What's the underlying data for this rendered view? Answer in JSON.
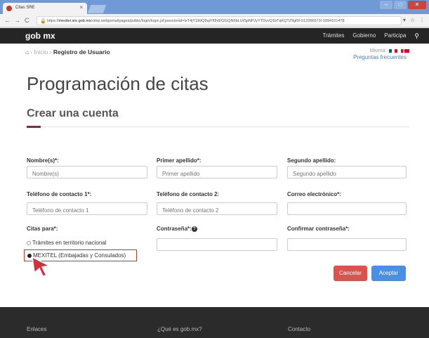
{
  "browser": {
    "tab_title": "Citas SRE",
    "tab_close": "×",
    "url_prefix": "https://",
    "url_domain": "mexitel.sre.gob.mx",
    "url_path": "/citas.webportal/pages/public/login/login.jsf;jsessionid=IxT4jY18dQ9qiYf0h8X2GQN6bLUtSpNPJyYTDvvQ1bTqKQTZ9gf9!-512366573!-1894101478"
  },
  "navbar": {
    "brand": "gob mx",
    "links": [
      "Trámites",
      "Gobierno",
      "Participa"
    ]
  },
  "breadcrumb": {
    "home": "Inicio",
    "separator": "›",
    "current": "Registro de Usuario"
  },
  "idioma_label": "Idioma",
  "faq_link": "Preguntas frecuentes",
  "page_title": "Programación de citas",
  "section_title": "Crear una cuenta",
  "form": {
    "nombre_label": "Nombre(s)*:",
    "nombre_placeholder": "Nombre(s)",
    "primer_label": "Primer apellido*:",
    "primer_placeholder": "Primer apellido",
    "segundo_label": "Segundo apellido:",
    "segundo_placeholder": "Segundo apellido",
    "tel1_label": "Teléfono de contacto 1*:",
    "tel1_placeholder": "Teléfono de contacto 1",
    "tel2_label": "Teléfono de contacto 2:",
    "tel2_placeholder": "Teléfono de contacto 2",
    "email_label": "Correo electrónico*:",
    "citas_label": "Citas para*:",
    "password_label": "Contraseña*:",
    "confirm_label": "Confirmar contraseña*:",
    "option_tramites": "Trámites en territorio nacional",
    "option_mexitel": "MEXITEL (Embajadas y Consulados)",
    "selected_option": "MEXITEL (Embajadas y Consulados)"
  },
  "buttons": {
    "cancel": "Cancelar",
    "accept": "Aceptar"
  },
  "footer": {
    "enlaces": "Enlaces",
    "que_es": "¿Qué es gob.mx?",
    "contacto": "Contacto"
  },
  "colors": {
    "accent": "#9d2235",
    "cancel": "#d9534f",
    "accept": "#4a90e2",
    "highlight_box": "#c0392b"
  }
}
